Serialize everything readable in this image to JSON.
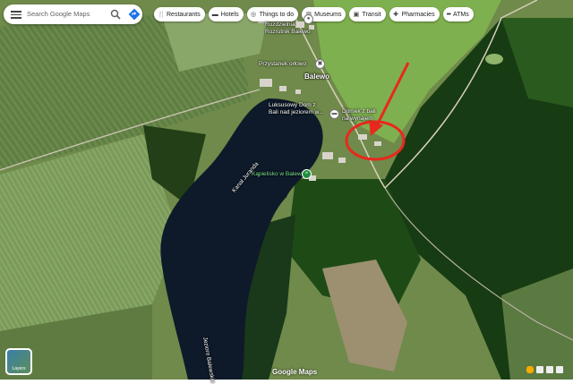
{
  "search": {
    "placeholder": "Search Google Maps",
    "menu_icon": "hamburger-menu-icon",
    "search_icon": "magnifier-icon",
    "directions_icon": "directions-diamond-icon"
  },
  "chips": [
    {
      "label": "Restaurants",
      "icon": "fork-knife-icon",
      "glyph": "🍴"
    },
    {
      "label": "Hotels",
      "icon": "bed-icon",
      "glyph": "▬"
    },
    {
      "label": "Things to do",
      "icon": "camera-icon",
      "glyph": "◎"
    },
    {
      "label": "Museums",
      "icon": "museum-icon",
      "glyph": "▥"
    },
    {
      "label": "Transit",
      "icon": "bus-icon",
      "glyph": "▣"
    },
    {
      "label": "Pharmacies",
      "icon": "pharmacy-icon",
      "glyph": "✚"
    },
    {
      "label": "ATMs",
      "icon": "more-icon",
      "glyph": "•••"
    }
  ],
  "map": {
    "labels": {
      "rozdzielnia": "Rozdzielnia\nRozrutnik Balewo",
      "przystanek": "Przystanek orłowo",
      "balewo": "Balewo",
      "luksusowy": "Luksusowy Dom z\nBali nad jeziorem w...",
      "domek": "Domek z bali\nna wynajem",
      "kapielisko": "Kąpielisko w Balewie",
      "kanal": "Kanał Juranda",
      "jezioro": "Jezioro Balewskie"
    },
    "annotation": {
      "color": "#e8281e"
    }
  },
  "layers": {
    "label": "Layers"
  },
  "brand": "Google Maps",
  "colors": {
    "farmland": "#6f8a4a",
    "forest": "#14330f",
    "water": "#0e1a2a"
  }
}
